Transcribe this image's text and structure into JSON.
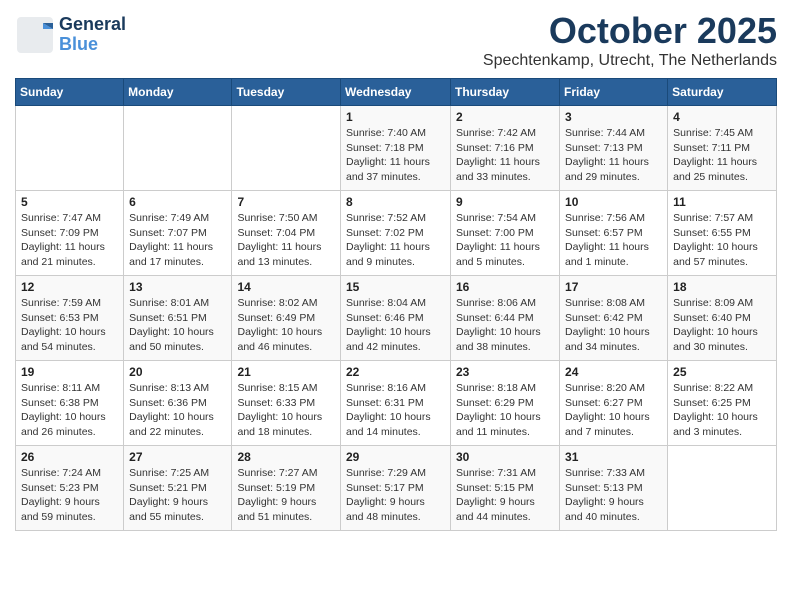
{
  "header": {
    "logo_line1": "General",
    "logo_line2": "Blue",
    "month": "October 2025",
    "subtitle": "Spechtenkamp, Utrecht, The Netherlands"
  },
  "weekdays": [
    "Sunday",
    "Monday",
    "Tuesday",
    "Wednesday",
    "Thursday",
    "Friday",
    "Saturday"
  ],
  "weeks": [
    [
      {
        "day": "",
        "info": ""
      },
      {
        "day": "",
        "info": ""
      },
      {
        "day": "",
        "info": ""
      },
      {
        "day": "1",
        "info": "Sunrise: 7:40 AM\nSunset: 7:18 PM\nDaylight: 11 hours\nand 37 minutes."
      },
      {
        "day": "2",
        "info": "Sunrise: 7:42 AM\nSunset: 7:16 PM\nDaylight: 11 hours\nand 33 minutes."
      },
      {
        "day": "3",
        "info": "Sunrise: 7:44 AM\nSunset: 7:13 PM\nDaylight: 11 hours\nand 29 minutes."
      },
      {
        "day": "4",
        "info": "Sunrise: 7:45 AM\nSunset: 7:11 PM\nDaylight: 11 hours\nand 25 minutes."
      }
    ],
    [
      {
        "day": "5",
        "info": "Sunrise: 7:47 AM\nSunset: 7:09 PM\nDaylight: 11 hours\nand 21 minutes."
      },
      {
        "day": "6",
        "info": "Sunrise: 7:49 AM\nSunset: 7:07 PM\nDaylight: 11 hours\nand 17 minutes."
      },
      {
        "day": "7",
        "info": "Sunrise: 7:50 AM\nSunset: 7:04 PM\nDaylight: 11 hours\nand 13 minutes."
      },
      {
        "day": "8",
        "info": "Sunrise: 7:52 AM\nSunset: 7:02 PM\nDaylight: 11 hours\nand 9 minutes."
      },
      {
        "day": "9",
        "info": "Sunrise: 7:54 AM\nSunset: 7:00 PM\nDaylight: 11 hours\nand 5 minutes."
      },
      {
        "day": "10",
        "info": "Sunrise: 7:56 AM\nSunset: 6:57 PM\nDaylight: 11 hours\nand 1 minute."
      },
      {
        "day": "11",
        "info": "Sunrise: 7:57 AM\nSunset: 6:55 PM\nDaylight: 10 hours\nand 57 minutes."
      }
    ],
    [
      {
        "day": "12",
        "info": "Sunrise: 7:59 AM\nSunset: 6:53 PM\nDaylight: 10 hours\nand 54 minutes."
      },
      {
        "day": "13",
        "info": "Sunrise: 8:01 AM\nSunset: 6:51 PM\nDaylight: 10 hours\nand 50 minutes."
      },
      {
        "day": "14",
        "info": "Sunrise: 8:02 AM\nSunset: 6:49 PM\nDaylight: 10 hours\nand 46 minutes."
      },
      {
        "day": "15",
        "info": "Sunrise: 8:04 AM\nSunset: 6:46 PM\nDaylight: 10 hours\nand 42 minutes."
      },
      {
        "day": "16",
        "info": "Sunrise: 8:06 AM\nSunset: 6:44 PM\nDaylight: 10 hours\nand 38 minutes."
      },
      {
        "day": "17",
        "info": "Sunrise: 8:08 AM\nSunset: 6:42 PM\nDaylight: 10 hours\nand 34 minutes."
      },
      {
        "day": "18",
        "info": "Sunrise: 8:09 AM\nSunset: 6:40 PM\nDaylight: 10 hours\nand 30 minutes."
      }
    ],
    [
      {
        "day": "19",
        "info": "Sunrise: 8:11 AM\nSunset: 6:38 PM\nDaylight: 10 hours\nand 26 minutes."
      },
      {
        "day": "20",
        "info": "Sunrise: 8:13 AM\nSunset: 6:36 PM\nDaylight: 10 hours\nand 22 minutes."
      },
      {
        "day": "21",
        "info": "Sunrise: 8:15 AM\nSunset: 6:33 PM\nDaylight: 10 hours\nand 18 minutes."
      },
      {
        "day": "22",
        "info": "Sunrise: 8:16 AM\nSunset: 6:31 PM\nDaylight: 10 hours\nand 14 minutes."
      },
      {
        "day": "23",
        "info": "Sunrise: 8:18 AM\nSunset: 6:29 PM\nDaylight: 10 hours\nand 11 minutes."
      },
      {
        "day": "24",
        "info": "Sunrise: 8:20 AM\nSunset: 6:27 PM\nDaylight: 10 hours\nand 7 minutes."
      },
      {
        "day": "25",
        "info": "Sunrise: 8:22 AM\nSunset: 6:25 PM\nDaylight: 10 hours\nand 3 minutes."
      }
    ],
    [
      {
        "day": "26",
        "info": "Sunrise: 7:24 AM\nSunset: 5:23 PM\nDaylight: 9 hours\nand 59 minutes."
      },
      {
        "day": "27",
        "info": "Sunrise: 7:25 AM\nSunset: 5:21 PM\nDaylight: 9 hours\nand 55 minutes."
      },
      {
        "day": "28",
        "info": "Sunrise: 7:27 AM\nSunset: 5:19 PM\nDaylight: 9 hours\nand 51 minutes."
      },
      {
        "day": "29",
        "info": "Sunrise: 7:29 AM\nSunset: 5:17 PM\nDaylight: 9 hours\nand 48 minutes."
      },
      {
        "day": "30",
        "info": "Sunrise: 7:31 AM\nSunset: 5:15 PM\nDaylight: 9 hours\nand 44 minutes."
      },
      {
        "day": "31",
        "info": "Sunrise: 7:33 AM\nSunset: 5:13 PM\nDaylight: 9 hours\nand 40 minutes."
      },
      {
        "day": "",
        "info": ""
      }
    ]
  ]
}
